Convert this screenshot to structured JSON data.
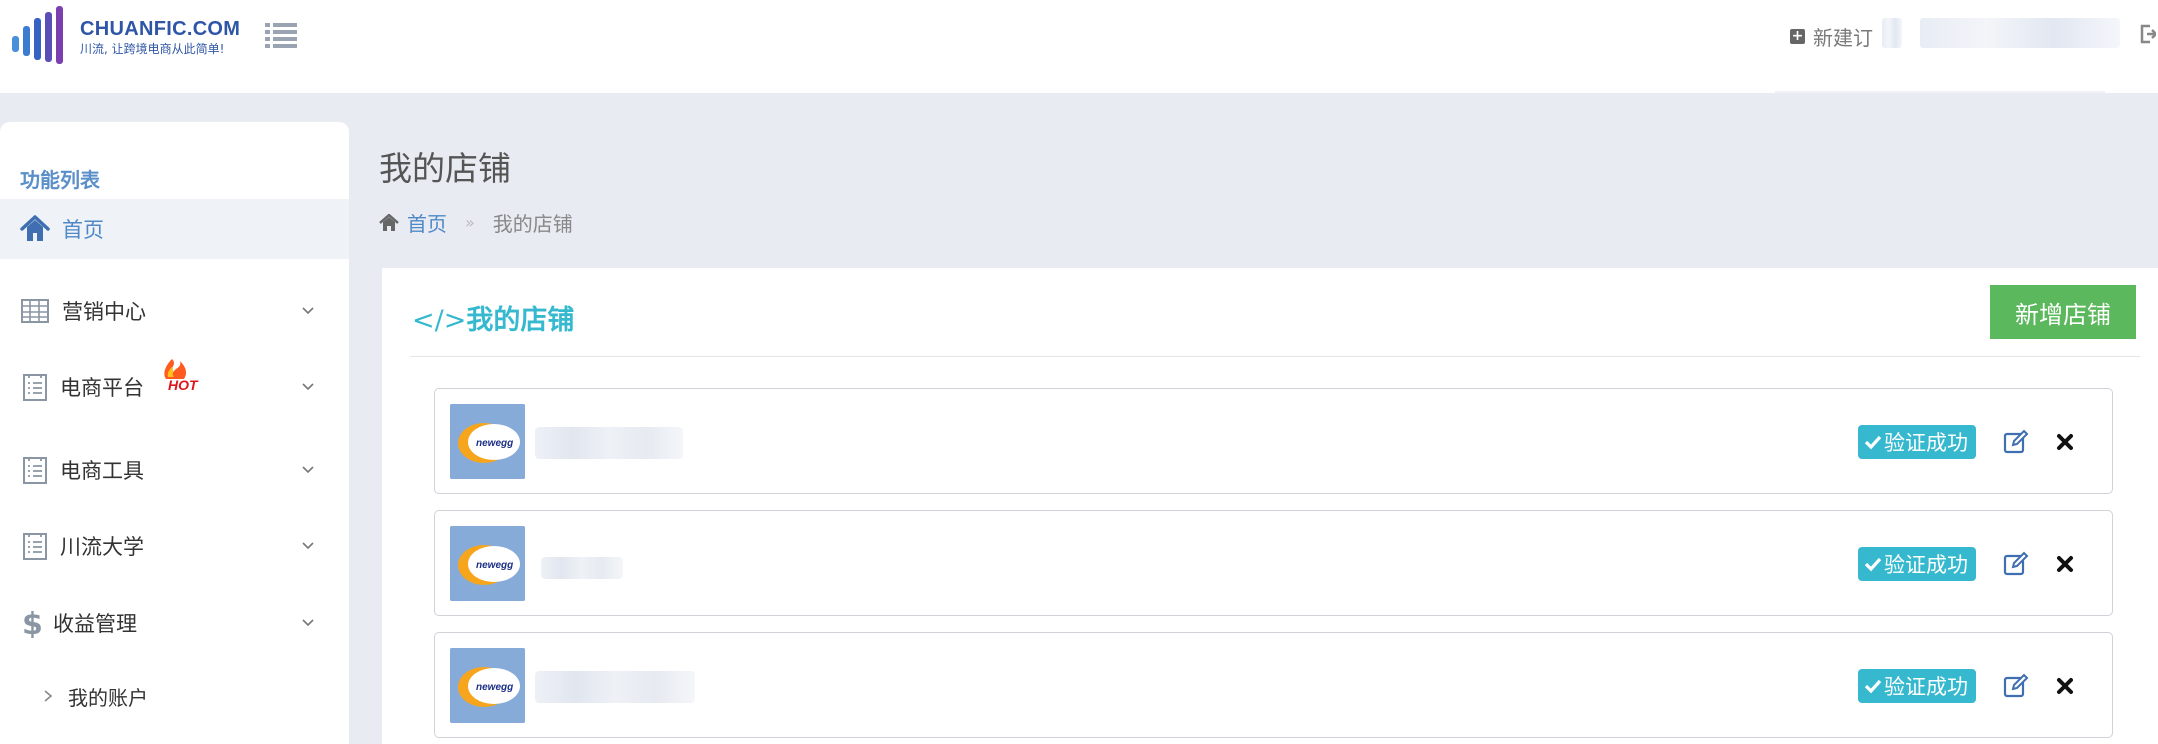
{
  "header": {
    "brand_name": "CHUANFIC.COM",
    "brand_slogan": "川流, 让跨境电商从此简单!",
    "new_order_label": "新建订"
  },
  "sidebar": {
    "heading": "功能列表",
    "items": [
      {
        "label": "首页",
        "icon": "home-icon",
        "active": true
      },
      {
        "label": "营销中心",
        "icon": "table-icon"
      },
      {
        "label": "电商平台",
        "icon": "list-doc-icon",
        "badge": "HOT"
      },
      {
        "label": "电商工具",
        "icon": "list-doc-icon"
      },
      {
        "label": "川流大学",
        "icon": "list-doc-icon"
      },
      {
        "label": "收益管理",
        "icon": "dollar-icon"
      }
    ],
    "sub_items": [
      {
        "label": "我的账户"
      }
    ]
  },
  "page": {
    "title": "我的店铺",
    "breadcrumb": {
      "home": "首页",
      "separator": "»",
      "current": "我的店铺"
    }
  },
  "panel": {
    "title": "我的店铺",
    "add_button": "新增店铺",
    "shops": [
      {
        "logo_text": "newegg",
        "status": "验证成功"
      },
      {
        "logo_text": "newegg",
        "status": "验证成功"
      },
      {
        "logo_text": "newegg",
        "status": "验证成功"
      }
    ]
  },
  "colors": {
    "accent_blue": "#4f88c6",
    "teal": "#36b9cf",
    "green": "#5cb85c",
    "page_bg": "#e9ebf3"
  }
}
